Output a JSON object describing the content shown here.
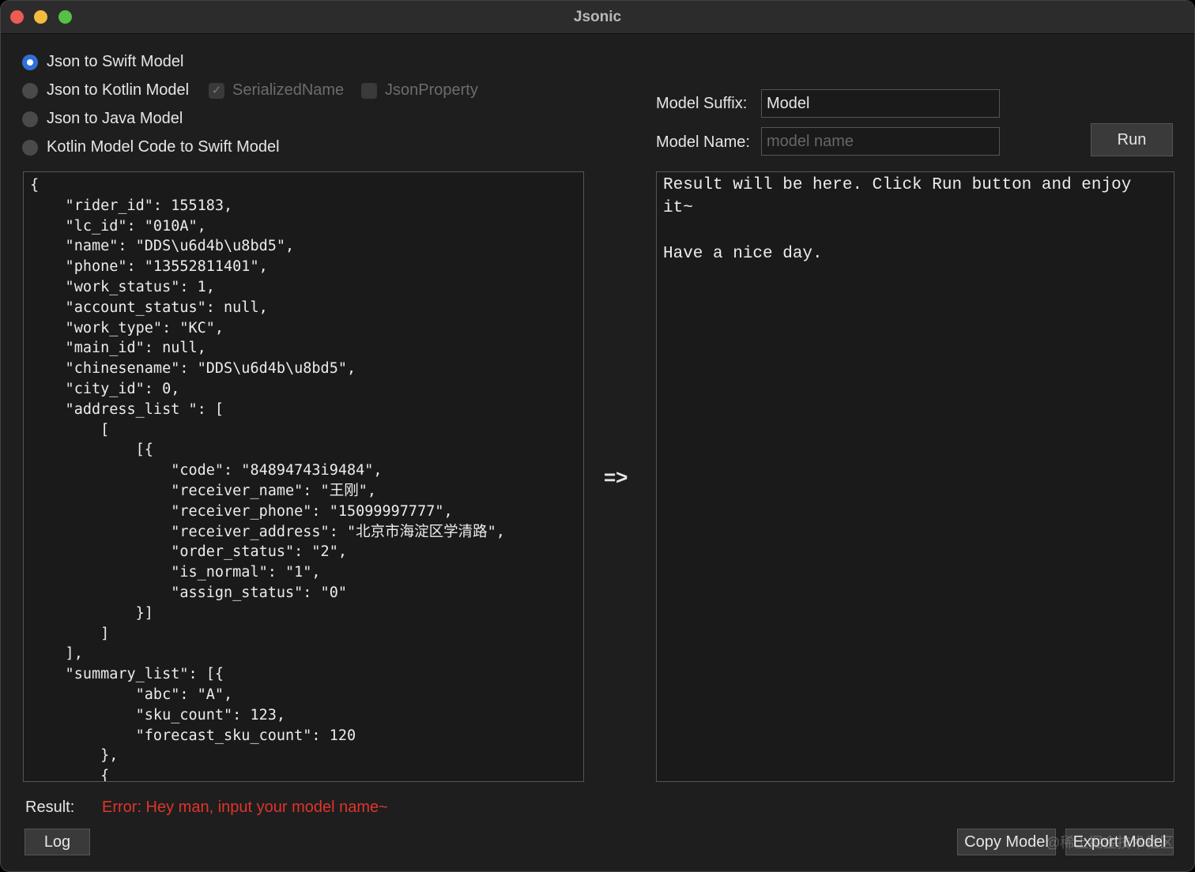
{
  "window": {
    "title": "Jsonic"
  },
  "modes": [
    {
      "label": "Json to Swift Model",
      "selected": true
    },
    {
      "label": "Json to Kotlin Model",
      "selected": false
    },
    {
      "label": "Json to Java Model",
      "selected": false
    },
    {
      "label": "Kotlin Model Code to Swift Model",
      "selected": false
    }
  ],
  "options": [
    {
      "label": "SerializedName",
      "checked": true,
      "enabled": false
    },
    {
      "label": "JsonProperty",
      "checked": false,
      "enabled": false
    }
  ],
  "model_suffix": {
    "label": "Model Suffix:",
    "value": "Model"
  },
  "model_name": {
    "label": "Model Name:",
    "value": "",
    "placeholder": "model name"
  },
  "run_label": "Run",
  "input_json": "{\n    \"rider_id\": 155183,\n    \"lc_id\": \"010A\",\n    \"name\": \"DDS\\u6d4b\\u8bd5\",\n    \"phone\": \"13552811401\",\n    \"work_status\": 1,\n    \"account_status\": null,\n    \"work_type\": \"KC\",\n    \"main_id\": null,\n    \"chinesename\": \"DDS\\u6d4b\\u8bd5\",\n    \"city_id\": 0,\n    \"address_list \": [\n        [\n            [{\n                \"code\": \"84894743i9484\",\n                \"receiver_name\": \"王刚\",\n                \"receiver_phone\": \"15099997777\",\n                \"receiver_address\": \"北京市海淀区学清路\",\n                \"order_status\": \"2\",\n                \"is_normal\": \"1\",\n                \"assign_status\": \"0\"\n            }]\n        ]\n    ],\n    \"summary_list\": [{\n            \"abc\": \"A\",\n            \"sku_count\": 123,\n            \"forecast_sku_count\": 120\n        },\n        {",
  "arrow": "=>",
  "output_text": "Result will be here. Click Run button and enjoy it~\n\nHave a nice day.",
  "result_label": "Result:",
  "result_message": "Error: Hey man, input your model name~",
  "error_color": "#e0342c",
  "log_label": "Log",
  "copy_label": "Copy Model",
  "export_label": "Export Model",
  "watermark": "@稀土掘金技术社区"
}
